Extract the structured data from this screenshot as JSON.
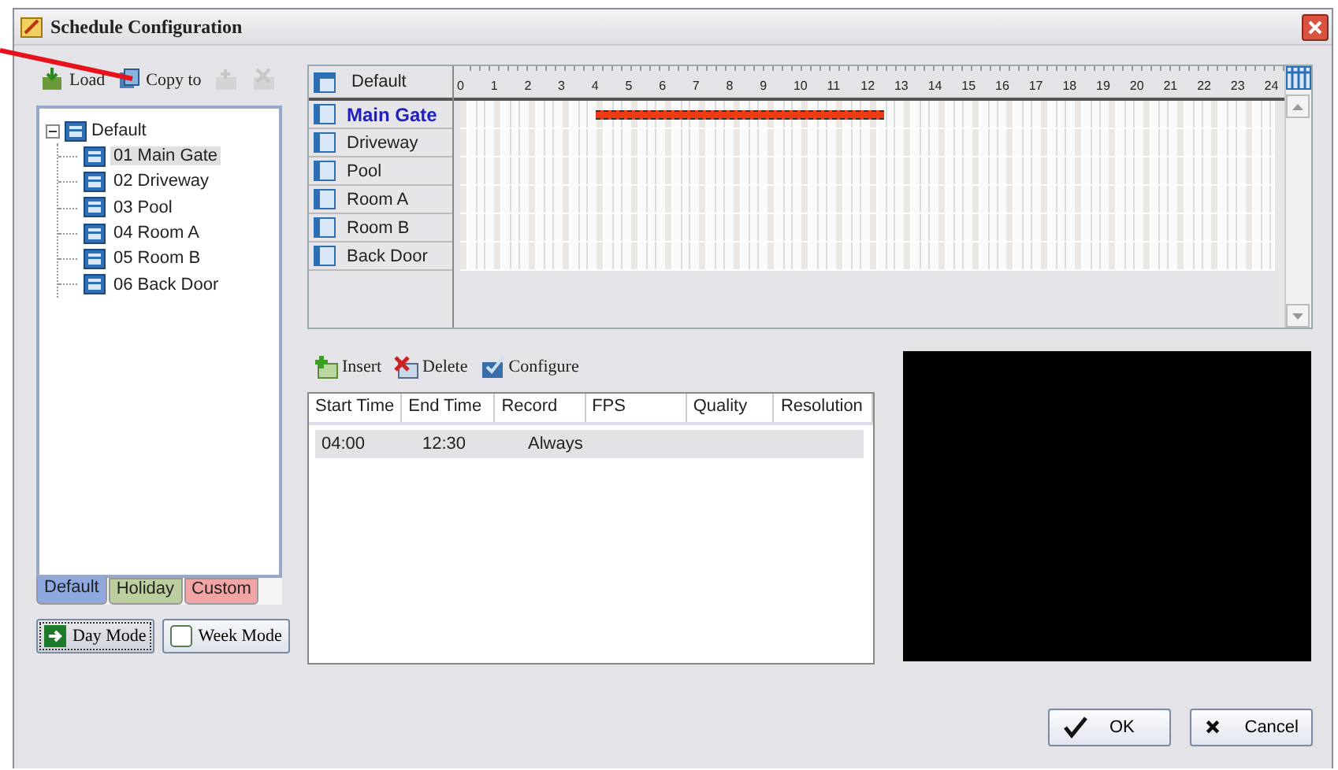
{
  "window": {
    "title": "Schedule Configuration"
  },
  "left_toolbar": [
    {
      "label": "Load",
      "kind": "load",
      "disabled": false
    },
    {
      "label": "Copy to",
      "kind": "copy",
      "disabled": false
    },
    {
      "kind": "export",
      "disabled": true
    },
    {
      "kind": "remove",
      "disabled": true
    }
  ],
  "tree": {
    "label": "Default",
    "expanded": true,
    "children": [
      {
        "label": "01 Main Gate",
        "selected": true
      },
      {
        "label": "02 Driveway",
        "selected": false
      },
      {
        "label": "03 Pool",
        "selected": false
      },
      {
        "label": "04 Room A",
        "selected": false
      },
      {
        "label": "05 Room B",
        "selected": false
      },
      {
        "label": "06 Back Door",
        "selected": false
      }
    ]
  },
  "schedule_tabs": [
    {
      "label": "Default",
      "selected": true,
      "color": "#8fa8e0"
    },
    {
      "label": "Holiday",
      "selected": false,
      "color": "#bccd9e"
    },
    {
      "label": "Custom",
      "selected": false,
      "color": "#f2a4a4"
    }
  ],
  "mode_buttons": [
    {
      "label": "Day Mode",
      "selected": true
    },
    {
      "label": "Week Mode",
      "selected": false
    }
  ],
  "timeline": {
    "header": "Default",
    "hours": [
      "0",
      "1",
      "2",
      "3",
      "4",
      "5",
      "6",
      "7",
      "8",
      "9",
      "10",
      "11",
      "12",
      "13",
      "14",
      "15",
      "16",
      "17",
      "18",
      "19",
      "20",
      "21",
      "22",
      "23",
      "24"
    ],
    "rows": [
      {
        "label": "Main Gate",
        "selected": true
      },
      {
        "label": "Driveway",
        "selected": false
      },
      {
        "label": "Pool",
        "selected": false
      },
      {
        "label": "Room A",
        "selected": false
      },
      {
        "label": "Room B",
        "selected": false
      },
      {
        "label": "Back Door",
        "selected": false
      }
    ]
  },
  "entry_toolbar": [
    {
      "label": "Insert",
      "kind": "insert"
    },
    {
      "label": "Delete",
      "kind": "delete"
    },
    {
      "label": "Configure",
      "kind": "configure"
    }
  ],
  "entries": {
    "columns": [
      "Start Time",
      "End Time",
      "Record",
      "FPS",
      "Quality",
      "Resolution"
    ],
    "rows": [
      {
        "start": "04:00",
        "end": "12:30",
        "record": "Always",
        "selected": true
      }
    ]
  },
  "buttons": [
    {
      "label": "OK",
      "kind": "ok"
    },
    {
      "label": "Cancel",
      "kind": "cancel"
    }
  ]
}
